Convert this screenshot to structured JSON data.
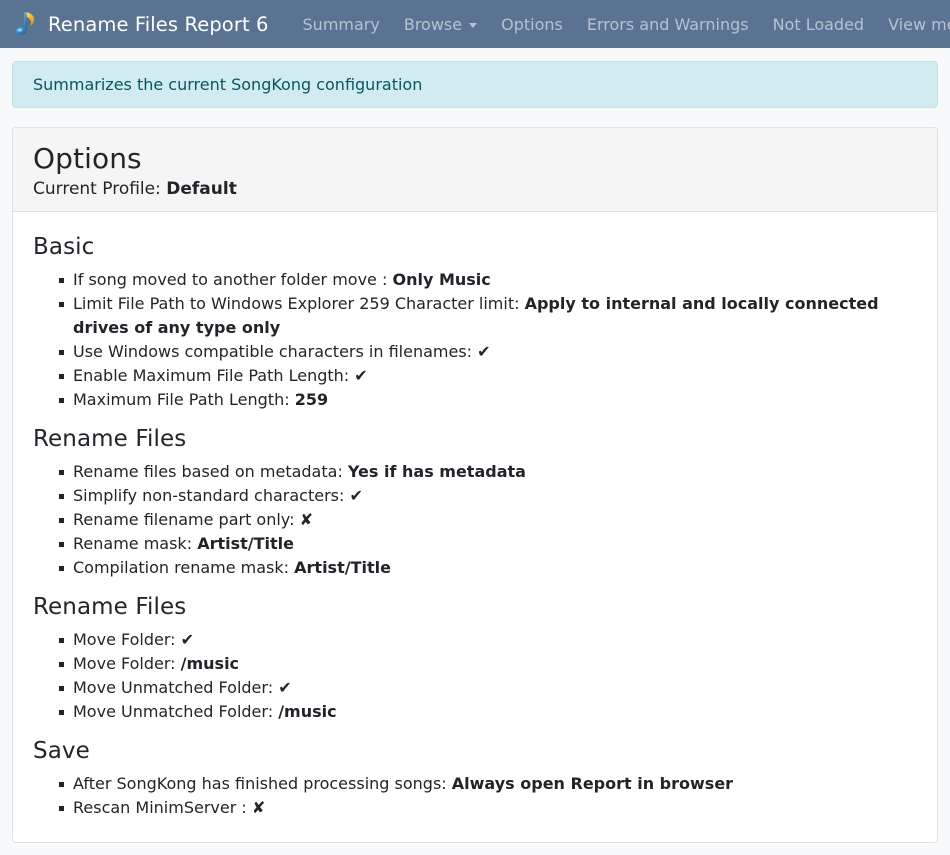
{
  "navbar": {
    "brand_title": "Rename Files Report 6",
    "logo_icon": "music-note-logo",
    "links": [
      {
        "label": "Summary",
        "has_caret": false
      },
      {
        "label": "Browse",
        "has_caret": true
      },
      {
        "label": "Options",
        "has_caret": false
      },
      {
        "label": "Errors and Warnings",
        "has_caret": false
      },
      {
        "label": "Not Loaded",
        "has_caret": false
      },
      {
        "label": "View metadata as Spreadsheet",
        "has_caret": false
      }
    ],
    "background_color": "#5a7393",
    "link_color": "#b6c2d2",
    "title_color": "#ffffff"
  },
  "alert": {
    "text": "Summarizes the current SongKong configuration",
    "background_color": "#d1ecf1",
    "text_color": "#0c5460"
  },
  "card": {
    "title": "Options",
    "profile_label": "Current Profile:",
    "profile_value": "Default"
  },
  "sections": [
    {
      "title": "Basic",
      "items": [
        {
          "label": "If song moved to another folder move :",
          "value": "Only Music",
          "mark": ""
        },
        {
          "label": "Limit File Path to Windows Explorer 259 Character limit:",
          "value": "Apply to internal and locally connected drives of any type only",
          "mark": ""
        },
        {
          "label": "Use Windows compatible characters in filenames:",
          "value": "",
          "mark": "✔"
        },
        {
          "label": "Enable Maximum File Path Length:",
          "value": "",
          "mark": "✔"
        },
        {
          "label": "Maximum File Path Length:",
          "value": "259",
          "mark": ""
        }
      ]
    },
    {
      "title": "Rename Files",
      "items": [
        {
          "label": "Rename files based on metadata:",
          "value": "Yes if has metadata",
          "mark": ""
        },
        {
          "label": "Simplify non-standard characters:",
          "value": "",
          "mark": "✔"
        },
        {
          "label": "Rename filename part only:",
          "value": "",
          "mark": "✘"
        },
        {
          "label": "Rename mask:",
          "value": "Artist/Title",
          "mark": ""
        },
        {
          "label": "Compilation rename mask:",
          "value": "Artist/Title",
          "mark": ""
        }
      ]
    },
    {
      "title": "Rename Files",
      "items": [
        {
          "label": "Move Folder:",
          "value": "",
          "mark": "✔"
        },
        {
          "label": "Move Folder:",
          "value": "/music",
          "mark": ""
        },
        {
          "label": "Move Unmatched Folder:",
          "value": "",
          "mark": "✔"
        },
        {
          "label": "Move Unmatched Folder:",
          "value": "/music",
          "mark": ""
        }
      ]
    },
    {
      "title": "Save",
      "items": [
        {
          "label": "After SongKong has finished processing songs:",
          "value": "Always open Report in browser",
          "mark": ""
        },
        {
          "label": "Rescan MinimServer :",
          "value": "",
          "mark": "✘"
        }
      ]
    }
  ]
}
